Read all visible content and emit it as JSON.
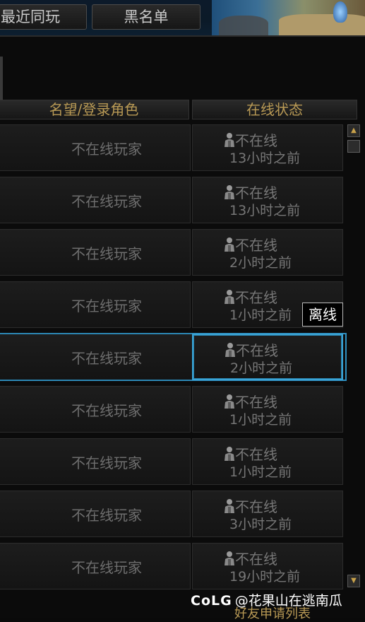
{
  "tabs": [
    "最近同玩",
    "黑名单"
  ],
  "columns": {
    "reputation": "名望/登录角色",
    "status": "在线状态"
  },
  "rows": [
    {
      "name": "不在线玩家",
      "status": "不在线",
      "time": "13小时之前"
    },
    {
      "name": "不在线玩家",
      "status": "不在线",
      "time": "13小时之前"
    },
    {
      "name": "不在线玩家",
      "status": "不在线",
      "time": "2小时之前"
    },
    {
      "name": "不在线玩家",
      "status": "不在线",
      "time": "1小时之前"
    },
    {
      "name": "不在线玩家",
      "status": "不在线",
      "time": "2小时之前"
    },
    {
      "name": "不在线玩家",
      "status": "不在线",
      "time": "1小时之前"
    },
    {
      "name": "不在线玩家",
      "status": "不在线",
      "time": "1小时之前"
    },
    {
      "name": "不在线玩家",
      "status": "不在线",
      "time": "3小时之前"
    },
    {
      "name": "不在线玩家",
      "status": "不在线",
      "time": "19小时之前"
    }
  ],
  "tooltip": "离线",
  "watermark": {
    "logo": "CoLG",
    "text": "@花果山在逃南瓜"
  },
  "footer_label": "好友申请列表",
  "colors": {
    "header_text": "#b99a55",
    "selected_border": "#2f8fc0",
    "dim_text": "#777777"
  },
  "icons": [
    "person-icon",
    "scroll-up-icon",
    "scroll-down-icon"
  ]
}
